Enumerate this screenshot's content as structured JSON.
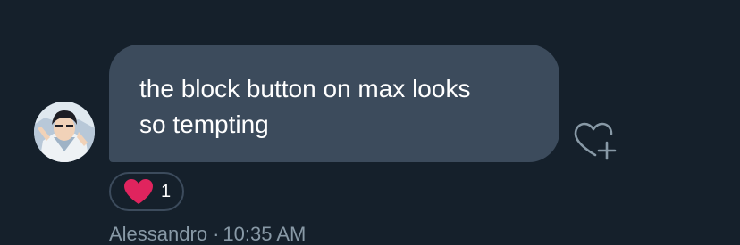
{
  "message": {
    "lines": [
      "the block button on max looks",
      "so tempting"
    ]
  },
  "reaction": {
    "emoji_icon": "heart-icon",
    "color": "#e0245e",
    "count": "1"
  },
  "add_reaction_icon": "heart-plus-icon",
  "sender": {
    "name": "Alessandro",
    "separator": "·",
    "time": "10:35 AM"
  },
  "colors": {
    "background": "#15202b",
    "bubble": "#3c4b5c",
    "meta_text": "#8899a6"
  }
}
